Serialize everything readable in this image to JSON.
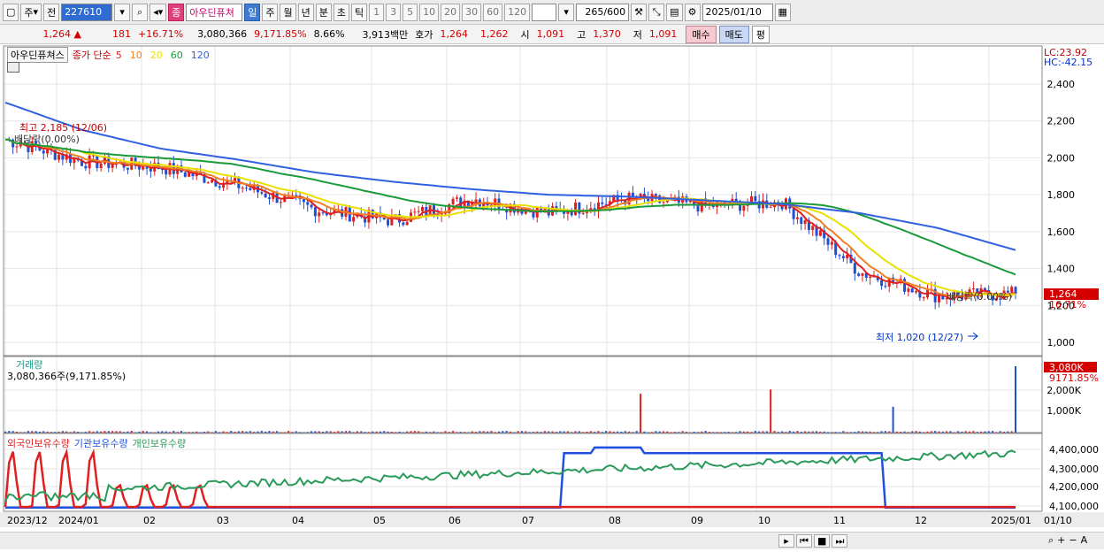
{
  "toolbar": {
    "market": "주",
    "prev_label": "전",
    "code": "227610",
    "stock_name": "아우딘퓨쳐",
    "badge": "종",
    "periods": [
      "일",
      "주",
      "월",
      "년",
      "분",
      "초",
      "틱"
    ],
    "active_period": "일",
    "numbers": [
      "1",
      "3",
      "5",
      "10",
      "20",
      "30",
      "60",
      "120"
    ],
    "count": "265",
    "count_total": "/600",
    "date": "2025/01/10"
  },
  "quote": {
    "price": "1,264",
    "change": "181",
    "change_pct": "+16.71%",
    "volume": "3,080,366",
    "volume_pct": "9,171.85%",
    "turnover_pct": "8.66%",
    "amount": "3,913백만",
    "hoga_label": "호가",
    "hoga1": "1,264",
    "hoga2": "1,262",
    "open_label": "시",
    "open": "1,091",
    "high_label": "고",
    "high": "1,370",
    "low_label": "저",
    "low": "1,091",
    "buy": "매수",
    "sell": "매도",
    "eval": "평"
  },
  "price_panel": {
    "name": "아우딘퓨쳐스",
    "series_label": "종가 단순",
    "ma_labels": [
      "5",
      "10",
      "20",
      "60",
      "120"
    ],
    "ma_colors": [
      "#e02020",
      "#f08020",
      "#e8e000",
      "#1a9a3a",
      "#3060e0"
    ],
    "lc": "LC:23.92",
    "hc": "HC:-42.15",
    "y_ticks": [
      "2,400",
      "2,200",
      "2,000",
      "1,800",
      "1,600",
      "1,400",
      "1,200",
      "1,000"
    ],
    "high_annot": "최고 2,185 (12/06)",
    "div_annot1": "배당락(0.00%)",
    "div_annot2": "배당락(0.00%)",
    "low_annot": "최저 1,020 (12/27)",
    "cur_price": "1,264",
    "cur_pct": "16.71%"
  },
  "volume_panel": {
    "title": "거래량",
    "value": "3,080,366주(9,171.85%)",
    "cur": "3,080K",
    "cur_pct": "9171.85%",
    "y_ticks": [
      "2,000K",
      "1,000K"
    ]
  },
  "holding_panel": {
    "labels": [
      "외국인보유수량",
      "기관보유수량",
      "개인보유수량"
    ],
    "colors": [
      "#e02020",
      "#2050e0",
      "#2a9a5a"
    ],
    "y_ticks": [
      "4,400,000",
      "4,300,000",
      "4,200,000",
      "4,100,000"
    ]
  },
  "x_axis": [
    "2023/12",
    "2024/01",
    "02",
    "03",
    "04",
    "05",
    "06",
    "07",
    "08",
    "09",
    "10",
    "11",
    "12",
    "2025/01",
    "01/10"
  ],
  "chart_data": {
    "type": "line",
    "x": [
      "2023/12",
      "2024/01",
      "02",
      "03",
      "04",
      "05",
      "06",
      "07",
      "08",
      "09",
      "10",
      "11",
      "12",
      "2025/01"
    ],
    "series": [
      {
        "name": "종가",
        "values": [
          2100,
          1980,
          1950,
          1850,
          1720,
          1660,
          1780,
          1700,
          1780,
          1740,
          1760,
          1380,
          1250,
          1264
        ]
      },
      {
        "name": "120",
        "values": [
          2300,
          2150,
          2050,
          1990,
          1920,
          1870,
          1830,
          1800,
          1790,
          1770,
          1750,
          1700,
          1620,
          1500
        ]
      }
    ],
    "ylim": [
      1000,
      2400
    ]
  }
}
